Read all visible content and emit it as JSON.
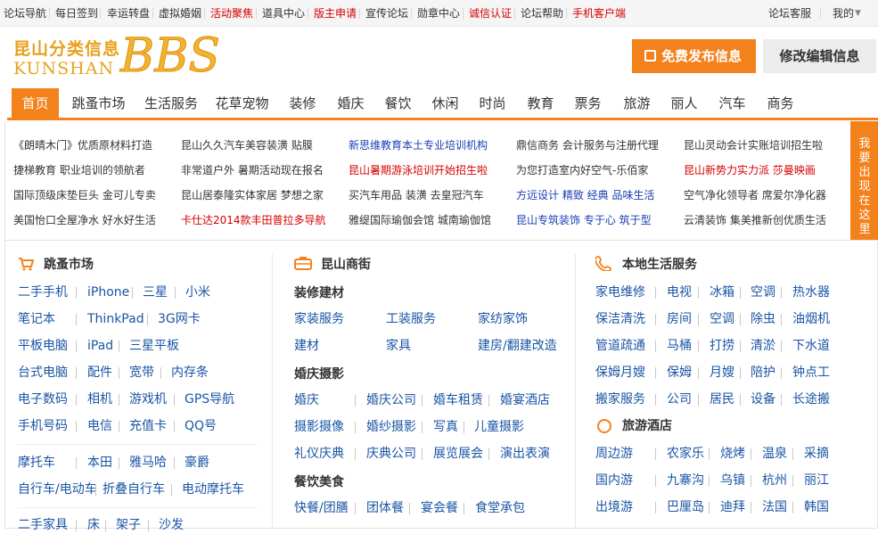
{
  "topbar": {
    "items": [
      {
        "label": "论坛导航",
        "style": "normal"
      },
      {
        "label": "每日签到",
        "style": "normal"
      },
      {
        "label": "幸运转盘",
        "style": "normal"
      },
      {
        "label": "虚拟婚姻",
        "style": "normal"
      },
      {
        "label": "活动聚焦",
        "style": "red"
      },
      {
        "label": "道具中心",
        "style": "normal"
      },
      {
        "label": "版主申请",
        "style": "red"
      },
      {
        "label": "宣传论坛",
        "style": "normal"
      },
      {
        "label": "勋章中心",
        "style": "normal"
      },
      {
        "label": "诚信认证",
        "style": "red"
      },
      {
        "label": "论坛帮助",
        "style": "normal"
      },
      {
        "label": "手机客户端",
        "style": "red"
      }
    ],
    "right": {
      "service": "论坛客服",
      "me": "我的"
    }
  },
  "logo": {
    "cn": "昆山分类信息",
    "en": "KUNSHAN",
    "mark": "BBS"
  },
  "header": {
    "publish": "免费发布信息",
    "edit": "修改编辑信息"
  },
  "nav": [
    "首页",
    "跳蚤市场",
    "生活服务",
    "花草宠物",
    "装修",
    "婚庆",
    "餐饮",
    "休闲",
    "时尚",
    "教育",
    "票务",
    "旅游",
    "丽人",
    "汽车",
    "商务"
  ],
  "ads": [
    [
      "《朗晴木门》优质原材料打造",
      "昆山久久汽车美容装潢 贴膜",
      "新思维教育本土专业培训机构",
      "鼎信商务 会计服务与注册代理",
      "昆山灵动会计实账培训招生啦"
    ],
    [
      "捷梯教育 职业培训的领航者",
      "非常道户外 暑期活动现在报名",
      "昆山暑期游泳培训开始招生啦",
      "为您打造室内好空气-乐佰家",
      "昆山新势力实力派  莎曼映画"
    ],
    [
      "国际顶级床垫巨头 金可儿专卖",
      "昆山居泰隆实体家居 梦想之家",
      "买汽车用品 装潢 去皇冠汽车",
      "方远设计  精致 经典 品味生活",
      "空气净化领导者 席爱尔净化器"
    ],
    [
      "美国怡口全屋净水 好水好生活",
      "卡仕达2014款丰田普拉多导航",
      "雅缇国际瑜伽会馆 城南瑜伽馆",
      "昆山专筑装饰 专于心 筑于型",
      "云清装饰 集美推新创优质生活"
    ]
  ],
  "ad_colors": {
    "blue": [
      "新思维教育本土专业培训机构",
      "方远设计  精致 经典 品味生活",
      "昆山专筑装饰 专于心 筑于型"
    ],
    "red": [
      "昆山暑期游泳培训开始招生啦",
      "昆山新势力实力派  莎曼映画",
      "卡仕达2014款丰田普拉多导航"
    ]
  },
  "ad_side": "我要出现在这里",
  "col1": {
    "title": "跳蚤市场",
    "rows": [
      [
        "二手手机",
        "iPhone",
        "三星",
        "小米"
      ],
      [
        "笔记本",
        "ThinkPad",
        "3G网卡"
      ],
      [
        "平板电脑",
        "iPad",
        "三星平板"
      ],
      [
        "台式电脑",
        "配件",
        "宽带",
        "内存条"
      ],
      [
        "电子数码",
        "相机",
        "游戏机",
        "GPS导航"
      ],
      [
        "手机号码",
        "电信",
        "充值卡",
        "QQ号"
      ],
      [
        "摩托车",
        "本田",
        "雅马哈",
        "豪爵"
      ],
      [
        "自行车/电动车",
        "折叠自行车",
        "电动摩托车"
      ],
      [
        "二手家具",
        "床",
        "架子",
        "沙发"
      ]
    ]
  },
  "col2": {
    "title": "昆山商街",
    "groups": [
      {
        "name": "装修建材",
        "rows": [
          [
            "家装服务",
            "工装服务",
            "家纺家饰"
          ],
          [
            "建材",
            "家具",
            "建房/翻建改造"
          ]
        ]
      },
      {
        "name": "婚庆摄影",
        "rows": [
          [
            "婚庆",
            "婚庆公司",
            "婚车租赁",
            "婚宴酒店"
          ],
          [
            "摄影摄像",
            "婚纱摄影",
            "写真",
            "儿童摄影"
          ],
          [
            "礼仪庆典",
            "庆典公司",
            "展览展会",
            "演出表演"
          ]
        ]
      },
      {
        "name": "餐饮美食",
        "rows": [
          [
            "快餐/团膳",
            "团体餐",
            "宴会餐",
            "食堂承包"
          ]
        ]
      }
    ]
  },
  "col3": {
    "title": "本地生活服务",
    "rows": [
      [
        "家电维修",
        "电视",
        "冰箱",
        "空调",
        "热水器"
      ],
      [
        "保洁清洗",
        "房间",
        "空调",
        "除虫",
        "油烟机"
      ],
      [
        "管道疏通",
        "马桶",
        "打捞",
        "清淤",
        "下水道"
      ],
      [
        "保姆月嫂",
        "保姆",
        "月嫂",
        "陪护",
        "钟点工"
      ],
      [
        "搬家服务",
        "公司",
        "居民",
        "设备",
        "长途搬"
      ]
    ],
    "title2": "旅游酒店",
    "rows2": [
      [
        "周边游",
        "农家乐",
        "烧烤",
        "温泉",
        "采摘"
      ],
      [
        "国内游",
        "九寨沟",
        "乌镇",
        "杭州",
        "丽江"
      ],
      [
        "出境游",
        "巴厘岛",
        "迪拜",
        "法国",
        "韩国"
      ]
    ]
  },
  "colors": {
    "accent": "#f3821d",
    "link": "#1a55a5",
    "red": "#d60000",
    "blue": "#1a3eb3"
  }
}
